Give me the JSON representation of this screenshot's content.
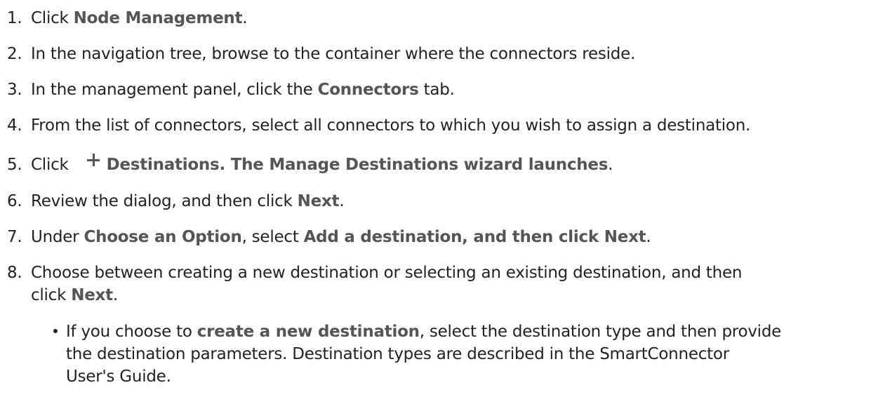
{
  "steps": [
    {
      "num": "1.",
      "pre": "Click ",
      "bold": "Node Management",
      "post": "."
    },
    {
      "num": "2.",
      "text": "In the navigation tree, browse to the container where the connectors reside."
    },
    {
      "num": "3.",
      "pre": "In the management panel, click the ",
      "bold": "Connectors",
      "post": " tab."
    },
    {
      "num": "4.",
      "text": "From the list of connectors, select all connectors to which you wish to assign a destination."
    },
    {
      "num": "5.",
      "pre": "Click",
      "icon": "plus-icon",
      "bold": "Destinations. The Manage Destinations wizard launches",
      "post": "."
    },
    {
      "num": "6.",
      "pre": "Review the dialog, and then click ",
      "bold": "Next",
      "post": "."
    },
    {
      "num": "7.",
      "pre": "Under ",
      "bold": "Choose an Option",
      "mid": ", select ",
      "bold2": "Add a destination, and then click Next",
      "post": "."
    },
    {
      "num": "8.",
      "line1": "Choose between creating a new destination or selecting an existing destination, and then",
      "pre2": "click ",
      "bold": "Next",
      "post": "."
    }
  ],
  "bullet": {
    "pre": "If you choose to ",
    "bold": "create a new destination",
    "post": ", select the destination type and then provide",
    "line2": "the destination parameters. Destination types are described in the SmartConnector",
    "line3": "User's Guide."
  }
}
